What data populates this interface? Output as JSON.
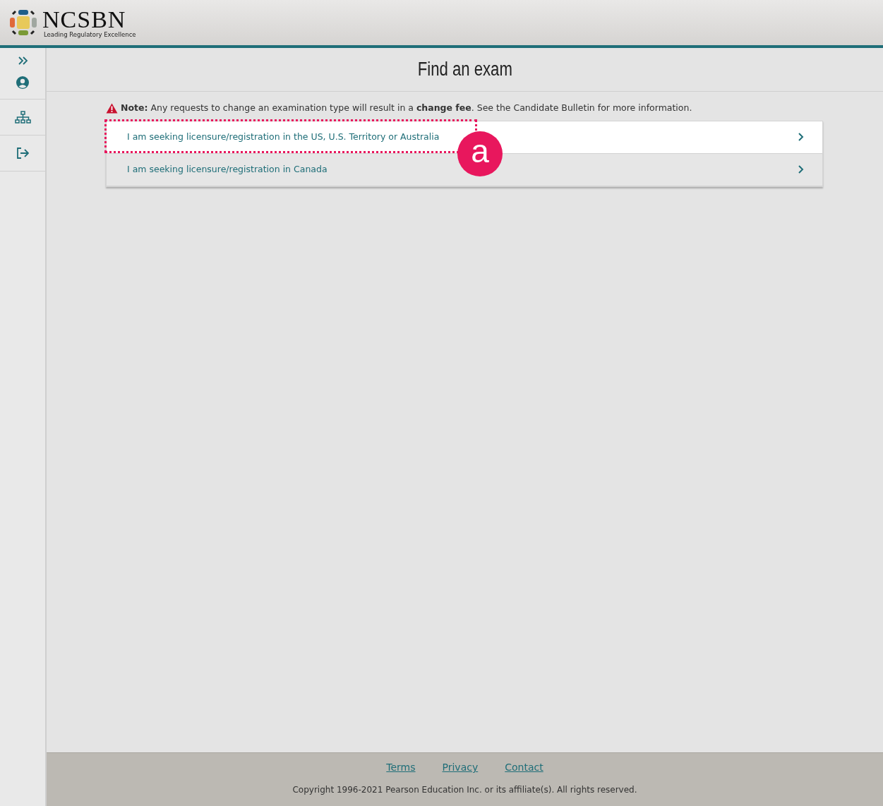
{
  "header": {
    "logo_name": "NCSBN",
    "logo_tagline": "Leading Regulatory Excellence"
  },
  "page_title": "Find an exam",
  "note": "**Note:** Any requests to change an examination type will result in a **change fee**. See the Candidate Bulletin  for more information.",
  "options": [
    {
      "label": "I am seeking licensure/registration in the US, U.S. Territory or Australia",
      "highlighted": true,
      "callout": "a"
    },
    {
      "label": "I am seeking licensure/registration in Canada",
      "highlighted": false
    }
  ],
  "footer": {
    "links": [
      "Terms",
      "Privacy",
      "Contact"
    ],
    "copyright": "Copyright 1996-2021 Pearson Education Inc. or its affiliate(s). All rights reserved."
  }
}
